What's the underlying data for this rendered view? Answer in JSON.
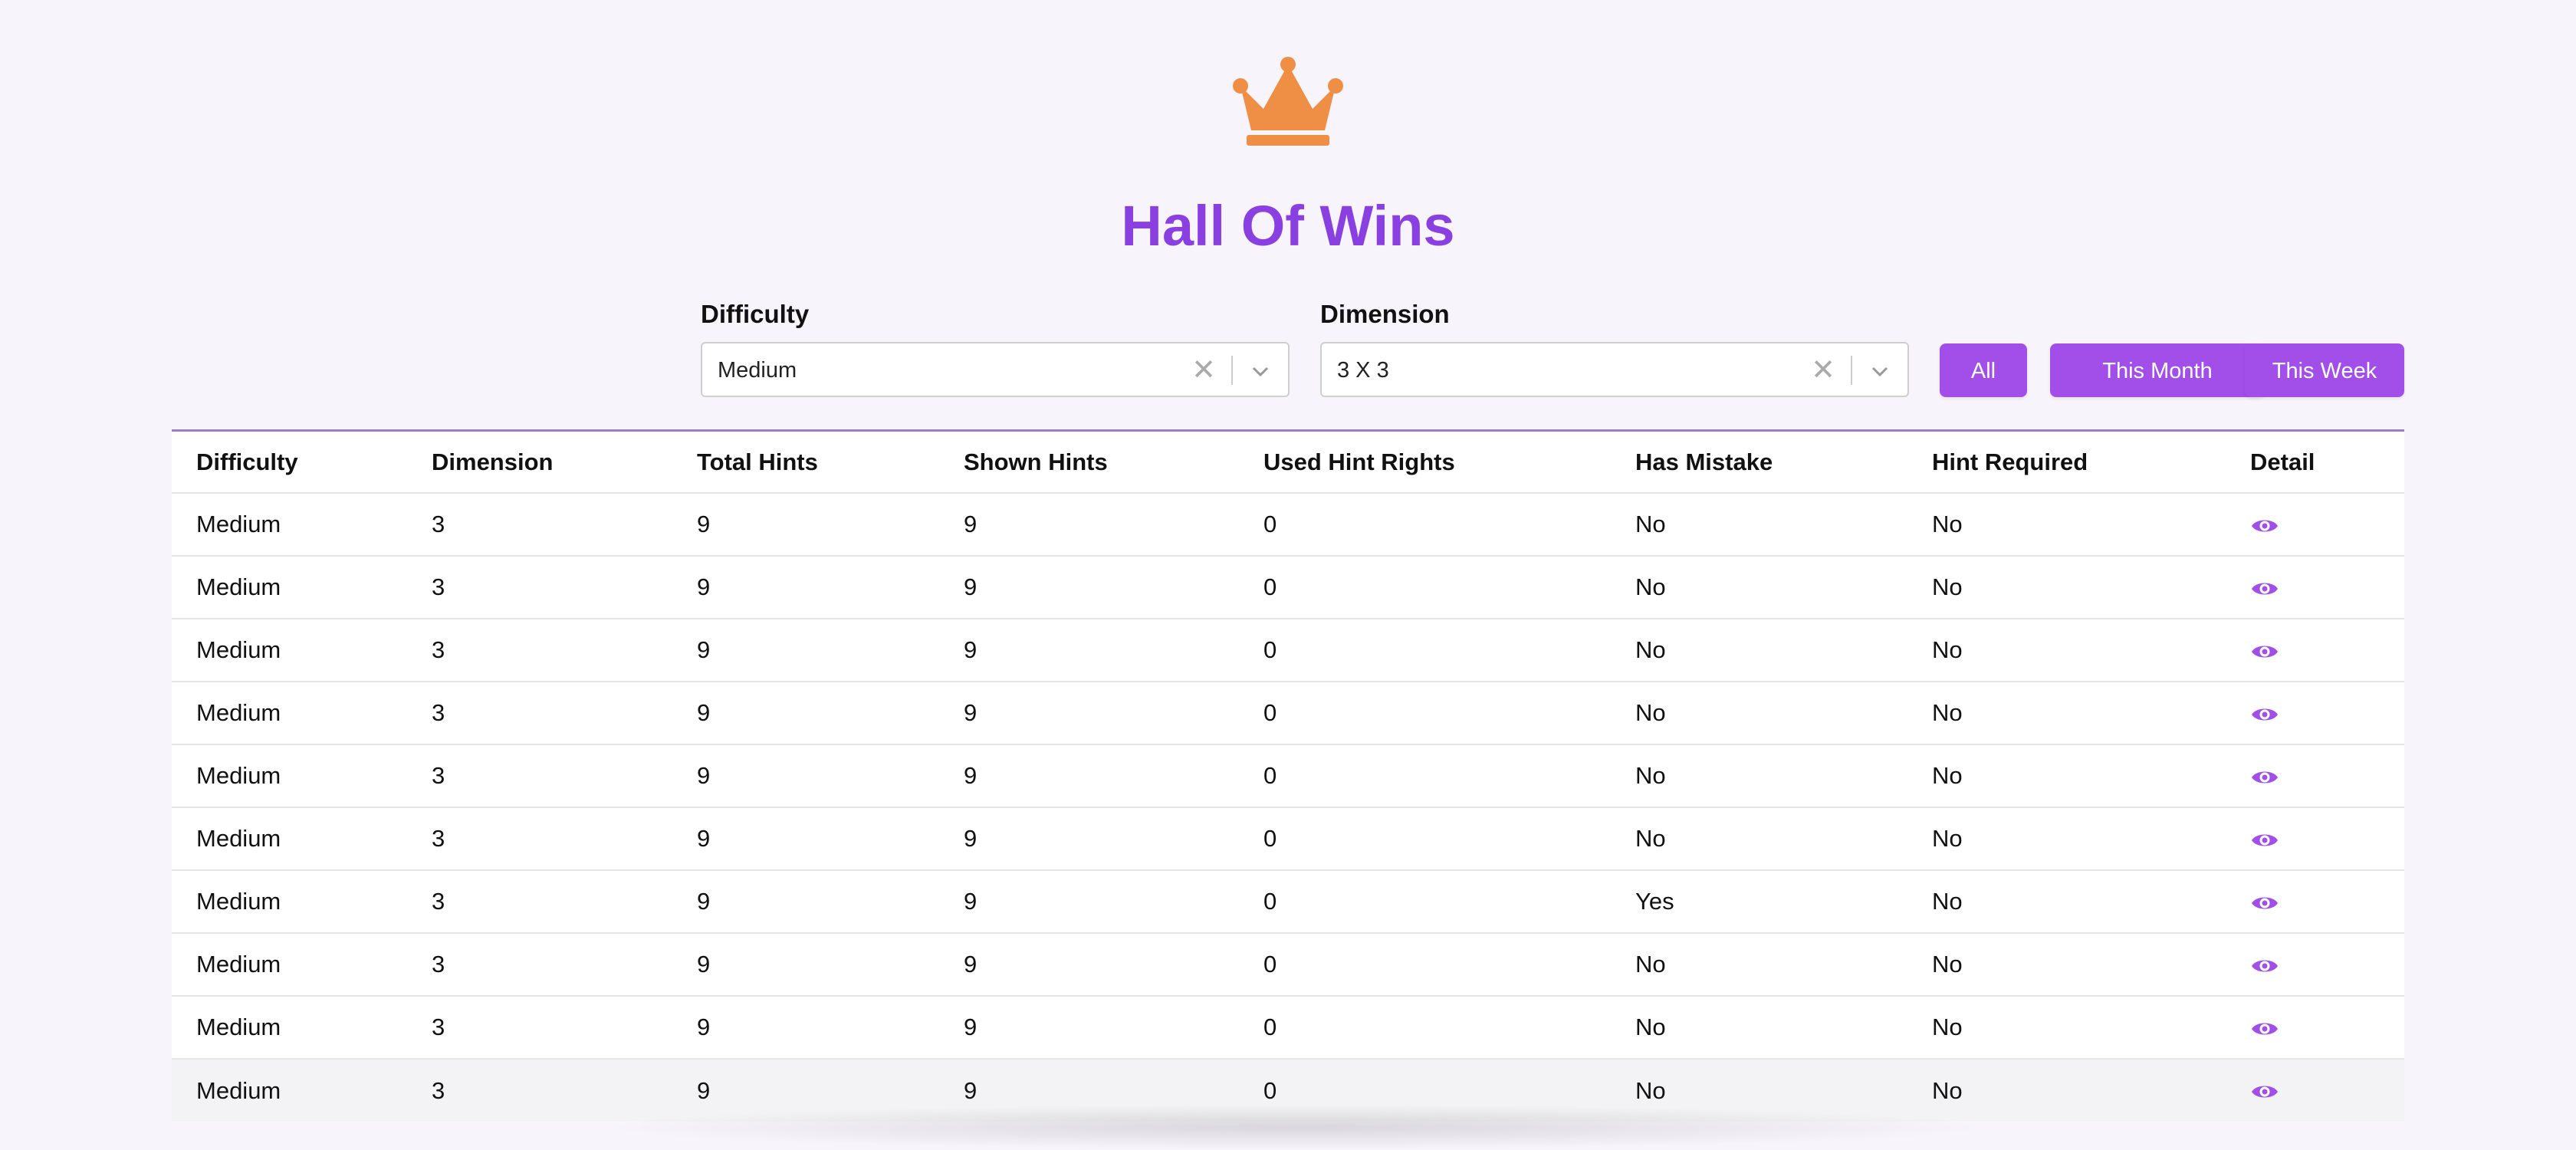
{
  "page": {
    "title": "Hall Of Wins",
    "accent_color": "#a14fe8",
    "title_color": "#8a3fe0",
    "crown_color": "#ef8f45",
    "icon": "crown-icon"
  },
  "filters": {
    "difficulty": {
      "label": "Difficulty",
      "value": "Medium",
      "clear_icon": "clear-icon",
      "dropdown_icon": "chevron-down-icon"
    },
    "dimension": {
      "label": "Dimension",
      "value": "3 X 3",
      "clear_icon": "clear-icon",
      "dropdown_icon": "chevron-down-icon"
    }
  },
  "buttons": {
    "all": "All",
    "this_month": "This Month",
    "this_week": "This Week"
  },
  "table": {
    "headers": [
      "Difficulty",
      "Dimension",
      "Total Hints",
      "Shown Hints",
      "Used Hint Rights",
      "Has Mistake",
      "Hint Required",
      "Detail"
    ],
    "detail_icon": "eye-icon",
    "rows": [
      [
        "Medium",
        "3",
        "9",
        "9",
        "0",
        "No",
        "No"
      ],
      [
        "Medium",
        "3",
        "9",
        "9",
        "0",
        "No",
        "No"
      ],
      [
        "Medium",
        "3",
        "9",
        "9",
        "0",
        "No",
        "No"
      ],
      [
        "Medium",
        "3",
        "9",
        "9",
        "0",
        "No",
        "No"
      ],
      [
        "Medium",
        "3",
        "9",
        "9",
        "0",
        "No",
        "No"
      ],
      [
        "Medium",
        "3",
        "9",
        "9",
        "0",
        "No",
        "No"
      ],
      [
        "Medium",
        "3",
        "9",
        "9",
        "0",
        "Yes",
        "No"
      ],
      [
        "Medium",
        "3",
        "9",
        "9",
        "0",
        "No",
        "No"
      ],
      [
        "Medium",
        "3",
        "9",
        "9",
        "0",
        "No",
        "No"
      ],
      [
        "Medium",
        "3",
        "9",
        "9",
        "0",
        "No",
        "No"
      ]
    ]
  }
}
